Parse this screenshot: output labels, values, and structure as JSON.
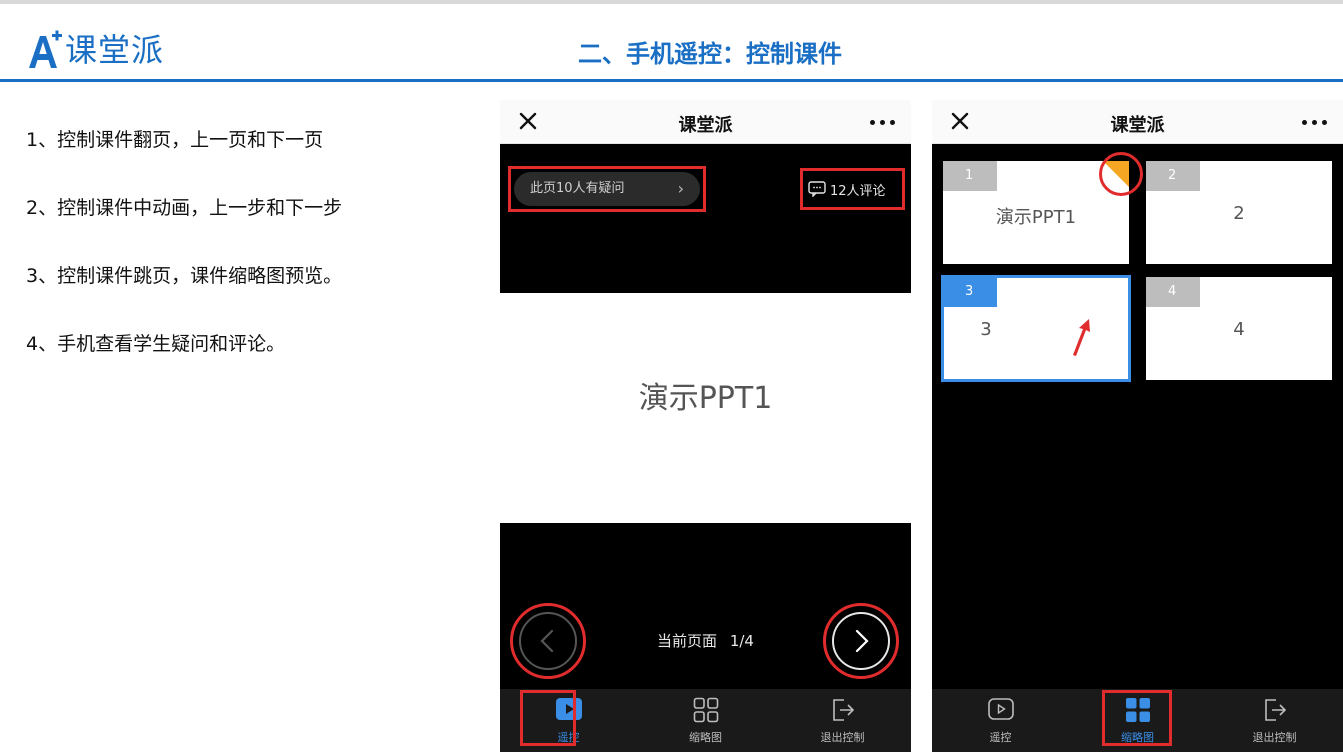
{
  "brand": {
    "logo_text": "课堂派",
    "accent_color": "#1a6fc4"
  },
  "slide": {
    "title": "二、手机遥控：控制课件"
  },
  "bullets": [
    "1、控制课件翻页，上一页和下一页",
    "2、控制课件中动画，上一步和下一步",
    "3、控制课件跳页，课件缩略图预览。",
    "4、手机查看学生疑问和评论。"
  ],
  "phone_remote": {
    "app_title": "课堂派",
    "question_label": "此页10人有疑问",
    "comment_label": "12人评论",
    "slide_text": "演示PPT1",
    "page_label": "当前页面",
    "page_value": "1/4",
    "tabs": [
      {
        "label": "遥控",
        "icon": "play-icon",
        "active": true
      },
      {
        "label": "缩略图",
        "icon": "grid-icon",
        "active": false
      },
      {
        "label": "退出控制",
        "icon": "exit-icon",
        "active": false
      }
    ]
  },
  "phone_thumbnails": {
    "app_title": "课堂派",
    "thumbnails": [
      {
        "number": "1",
        "title": "演示PPT1"
      },
      {
        "number": "2",
        "title": "2"
      },
      {
        "number": "3",
        "title": "3"
      },
      {
        "number": "4",
        "title": "4"
      }
    ],
    "tabs": [
      {
        "label": "遥控",
        "icon": "play-icon",
        "active": false
      },
      {
        "label": "缩略图",
        "icon": "grid-icon",
        "active": true
      },
      {
        "label": "退出控制",
        "icon": "exit-icon",
        "active": false
      }
    ]
  },
  "colors": {
    "highlight_red": "#e02c2c",
    "active_blue": "#3a8ee6",
    "corner_orange": "#f5a623"
  }
}
